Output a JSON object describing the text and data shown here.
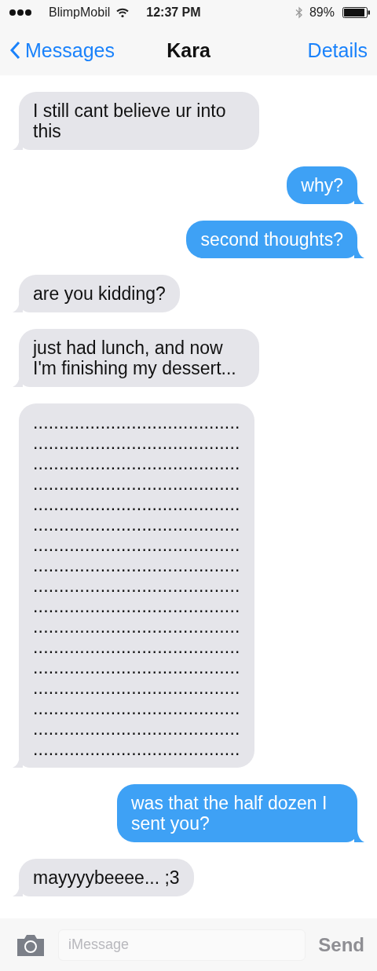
{
  "status_bar": {
    "carrier": "BlimpMobil",
    "time": "12:37 PM",
    "battery": "89%"
  },
  "nav": {
    "back": "Messages",
    "title": "Kara",
    "action": "Details"
  },
  "messages": [
    {
      "kind": "incoming",
      "text": "I still cant believe ur into this"
    },
    {
      "kind": "outgoing",
      "text": "why?"
    },
    {
      "kind": "outgoing",
      "text": "second thoughts?"
    },
    {
      "kind": "incoming",
      "text": "are you kidding?"
    },
    {
      "kind": "incoming",
      "text": "just had lunch, and now I'm finishing my dessert..."
    },
    {
      "kind": "incoming",
      "lines": [
        "........................................",
        "........................................",
        "........................................",
        "........................................",
        "........................................",
        "........................................",
        "........................................",
        "........................................",
        "........................................",
        "........................................",
        "........................................",
        "........................................",
        "........................................",
        "........................................",
        "........................................",
        "........................................",
        "........................................"
      ]
    },
    {
      "kind": "outgoing",
      "text": "was that the half dozen I sent you?"
    },
    {
      "kind": "incoming",
      "text": "mayyyybeeee... ;3"
    }
  ],
  "composer": {
    "placeholder": "iMessage",
    "send": "Send"
  }
}
